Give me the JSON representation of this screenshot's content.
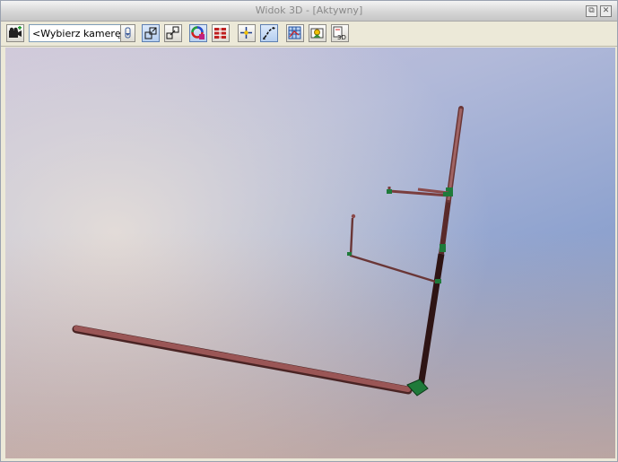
{
  "window": {
    "title": "Widok 3D - [Aktywny]",
    "controls": {
      "restore": "⧉",
      "close": "✕"
    }
  },
  "toolbar": {
    "camera_combo": {
      "value": "<Wybierz kamerę>"
    },
    "buttons": [
      {
        "name": "add-camera-button",
        "icon": "camera-add-icon"
      },
      {
        "name": "combo-arrow-button",
        "icon": "arrow-down-icon"
      },
      {
        "name": "zoom-window-button",
        "icon": "zoom-window-icon",
        "active": true
      },
      {
        "name": "zoom-out-button",
        "icon": "zoom-out-icon"
      },
      {
        "name": "color-wheel-button",
        "icon": "color-wheel-icon",
        "active": true
      },
      {
        "name": "layers-button",
        "icon": "layers-icon"
      },
      {
        "name": "rotate-button",
        "icon": "rotate-icon"
      },
      {
        "name": "pan-button",
        "icon": "pan-icon",
        "active": true
      },
      {
        "name": "grid-view-button",
        "icon": "grid-view-icon"
      },
      {
        "name": "render-button",
        "icon": "render-icon"
      },
      {
        "name": "view-3d-button",
        "icon": "view-3d-icon"
      }
    ]
  },
  "scene": {
    "pipe_color": "#8b4a4a",
    "fitting_color": "#1f7a3a",
    "background_accent": "#8fa3cf"
  }
}
